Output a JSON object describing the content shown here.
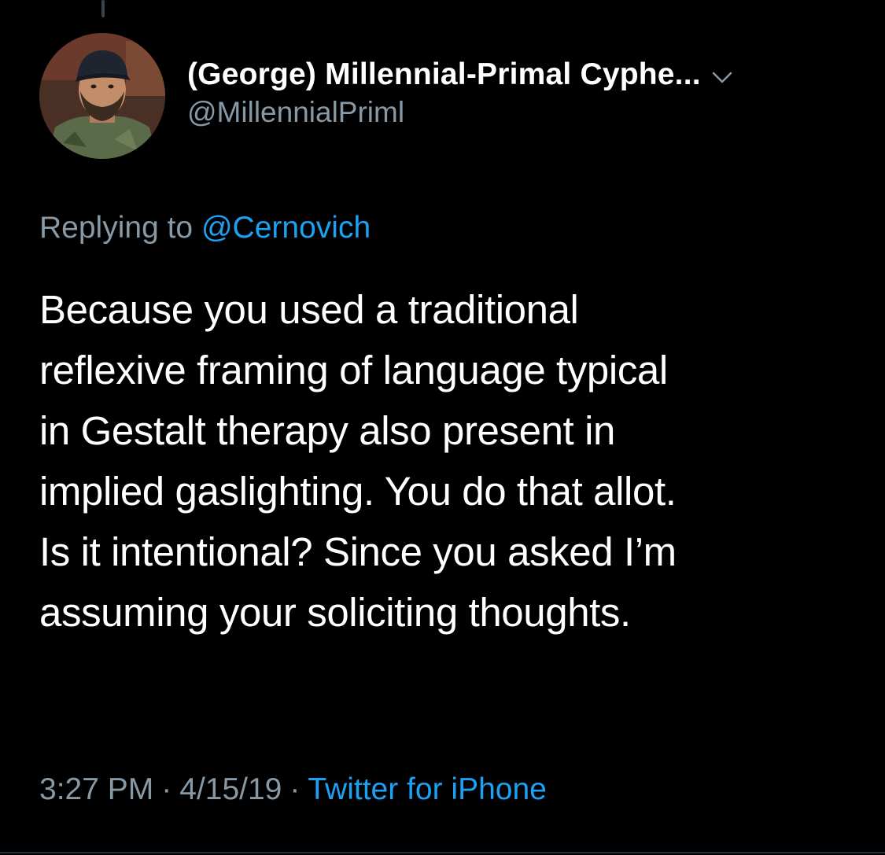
{
  "tweet": {
    "author": {
      "display_name": "(George) Millennial-Primal Cyphe...",
      "handle": "@MillennialPriml",
      "avatar_icon": "profile-photo"
    },
    "reply_prefix": "Replying to",
    "reply_to": "@Cernovich",
    "body_lines": [
      "Because you used a traditional",
      "reflexive framing of language typical",
      "in Gestalt therapy also present in",
      "implied gaslighting. You do that allot.",
      "Is it intentional? Since you asked I’m",
      "assuming your soliciting thoughts."
    ],
    "time": "3:27 PM",
    "separator": "·",
    "date": "4/15/19",
    "source": "Twitter for iPhone"
  },
  "colors": {
    "background": "#000000",
    "text": "#ffffff",
    "muted": "#8899a6",
    "link": "#1da1f2"
  }
}
